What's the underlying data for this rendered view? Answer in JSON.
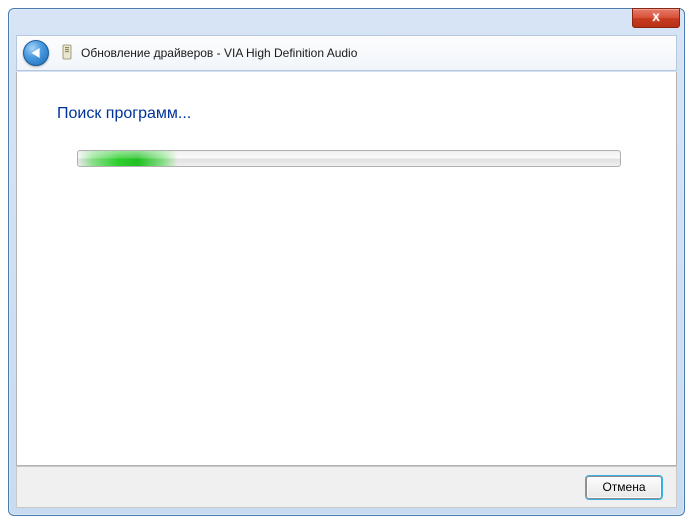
{
  "titlebar": {
    "close_symbol": "X"
  },
  "header": {
    "title": "Обновление драйверов - VIA High Definition Audio"
  },
  "content": {
    "heading": "Поиск программ...",
    "progress_percent": 18
  },
  "footer": {
    "cancel_label": "Отмена"
  }
}
